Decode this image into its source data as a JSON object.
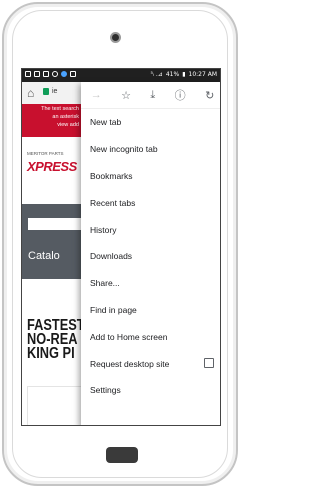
{
  "status": {
    "battery": "41%",
    "time": "10:27 AM",
    "signal_text": "⁵ᵢ .⊿"
  },
  "browser": {
    "url": "ie"
  },
  "webpage": {
    "banner_lines": [
      "The text search",
      "an asterisk",
      "view add"
    ],
    "logo_small": "MERITOR PARTS",
    "logo_big": "XPRESS",
    "catalog_label": "Catalo",
    "headline_lines": [
      "FASTEST",
      "NO-REA",
      "KING PI"
    ]
  },
  "menu": {
    "top_icons": [
      "forward-arrow",
      "star",
      "download",
      "info",
      "refresh"
    ],
    "items": [
      {
        "label": "New tab"
      },
      {
        "label": "New incognito tab"
      },
      {
        "label": "Bookmarks"
      },
      {
        "label": "Recent tabs"
      },
      {
        "label": "History"
      },
      {
        "label": "Downloads"
      },
      {
        "label": "Share..."
      },
      {
        "label": "Find in page"
      },
      {
        "label": "Add to Home screen"
      },
      {
        "label": "Request desktop site"
      },
      {
        "label": "Settings"
      }
    ],
    "checkbox_checked": false
  }
}
